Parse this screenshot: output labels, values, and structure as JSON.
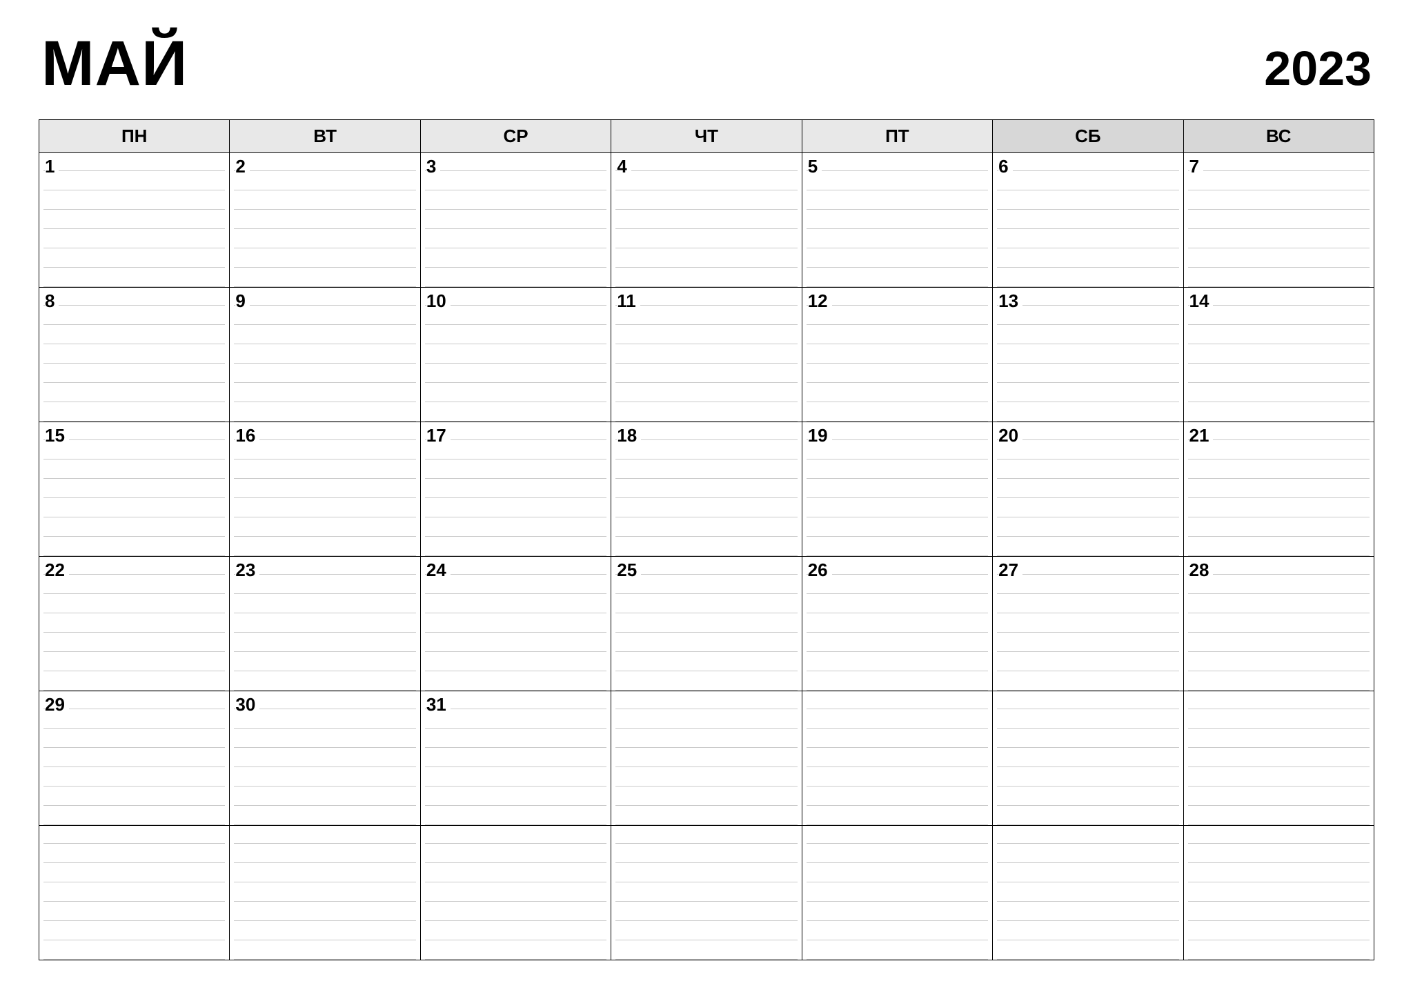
{
  "header": {
    "month": "МАЙ",
    "year": "2023"
  },
  "weekdays": [
    "ПН",
    "ВТ",
    "СР",
    "ЧТ",
    "ПТ",
    "СБ",
    "ВС"
  ],
  "weeks": [
    [
      "1",
      "2",
      "3",
      "4",
      "5",
      "6",
      "7"
    ],
    [
      "8",
      "9",
      "10",
      "11",
      "12",
      "13",
      "14"
    ],
    [
      "15",
      "16",
      "17",
      "18",
      "19",
      "20",
      "21"
    ],
    [
      "22",
      "23",
      "24",
      "25",
      "26",
      "27",
      "28"
    ],
    [
      "29",
      "30",
      "31",
      "",
      "",
      "",
      ""
    ],
    [
      "",
      "",
      "",
      "",
      "",
      "",
      ""
    ]
  ]
}
